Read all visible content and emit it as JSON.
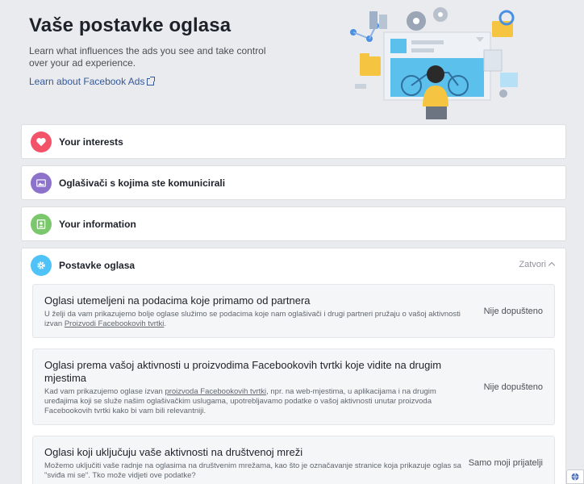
{
  "header": {
    "title": "Vaše postavke oglasa",
    "subtitle": "Learn what influences the ads you see and take control over your ad experience.",
    "learn_link": "Learn about Facebook Ads"
  },
  "sections": [
    {
      "label": "Your interests",
      "icon": "heart-icon",
      "color": "#f35369"
    },
    {
      "label": "Oglašivači s kojima ste komunicirali",
      "icon": "image-icon",
      "color": "#8c72cb"
    },
    {
      "label": "Your information",
      "icon": "person-icon",
      "color": "#7bc86c"
    },
    {
      "label": "Postavke oglasa",
      "icon": "gear-icon",
      "color": "#4fc3f7",
      "close_label": "Zatvori"
    }
  ],
  "settings": [
    {
      "title": "Oglasi utemeljeni na podacima koje primamo od partnera",
      "desc_pre": "U želji da vam prikazujemo bolje oglase služimo se podacima koje nam oglašivači i drugi partneri pružaju o vašoj aktivnosti izvan ",
      "desc_link": "Proizvodi Facebookovih tvrtki",
      "desc_post": ".",
      "status": "Nije dopušteno"
    },
    {
      "title": "Oglasi prema vašoj aktivnosti u proizvodima Facebookovih tvrtki koje vidite na drugim mjestima",
      "desc_pre": "Kad vam prikazujemo oglase izvan ",
      "desc_link": "proizvoda Facebookovih tvrtki",
      "desc_post": ", npr. na web-mjestima, u aplikacijama i na drugim uređajima koji se služe našim oglašivačkim uslugama, upotrebljavamo podatke o vašoj aktivnosti unutar proizvoda Facebookovih tvrtki kako bi vam bili relevantniji.",
      "status": "Nije dopušteno"
    },
    {
      "title": "Oglasi koji uključuju vaše aktivnosti na društvenoj mreži",
      "desc_pre": "Možemo uključiti vaše radnje na oglasima na društvenim mrežama, kao što je označavanje stranice koja prikazuje oglas sa \"sviđa mi se\". Tko može vidjeti ove podatke?",
      "desc_link": "",
      "desc_post": "",
      "status": "Samo moji prijatelji"
    }
  ]
}
